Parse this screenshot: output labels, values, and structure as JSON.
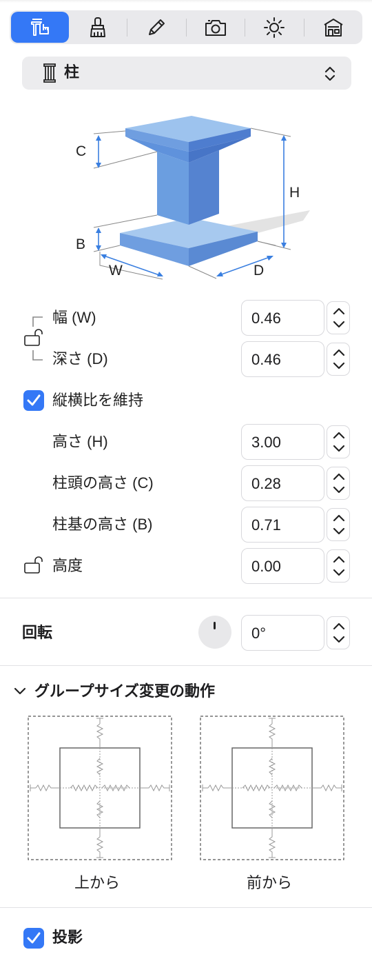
{
  "toolbar": {
    "tabs": [
      {
        "icon": "measure-icon",
        "active": true
      },
      {
        "icon": "brush-icon",
        "active": false
      },
      {
        "icon": "pencil-icon",
        "active": false
      },
      {
        "icon": "camera-icon",
        "active": false
      },
      {
        "icon": "sun-icon",
        "active": false
      },
      {
        "icon": "house-icon",
        "active": false
      }
    ],
    "accent": "#3478f6"
  },
  "type_selector": {
    "icon": "column-icon",
    "value": "柱"
  },
  "diagram": {
    "labels": {
      "c": "C",
      "b": "B",
      "h": "H",
      "w": "W",
      "d": "D"
    }
  },
  "fields": {
    "width": {
      "label": "幅 (W)",
      "value": "0.46"
    },
    "depth": {
      "label": "深さ (D)",
      "value": "0.46"
    },
    "keep_ratio": {
      "label": "縦横比を維持",
      "checked": true
    },
    "height": {
      "label": "高さ (H)",
      "value": "3.00"
    },
    "capital_height": {
      "label": "柱頭の高さ (C)",
      "value": "0.28"
    },
    "base_height": {
      "label": "柱基の高さ (B)",
      "value": "0.71"
    },
    "elevation": {
      "label": "高度",
      "value": "0.00"
    }
  },
  "rotation": {
    "label": "回転",
    "value": "0°"
  },
  "group_resize": {
    "title": "グループサイズ変更の動作",
    "top_caption": "上から",
    "front_caption": "前から"
  },
  "shadow": {
    "label": "投影",
    "checked": true
  }
}
